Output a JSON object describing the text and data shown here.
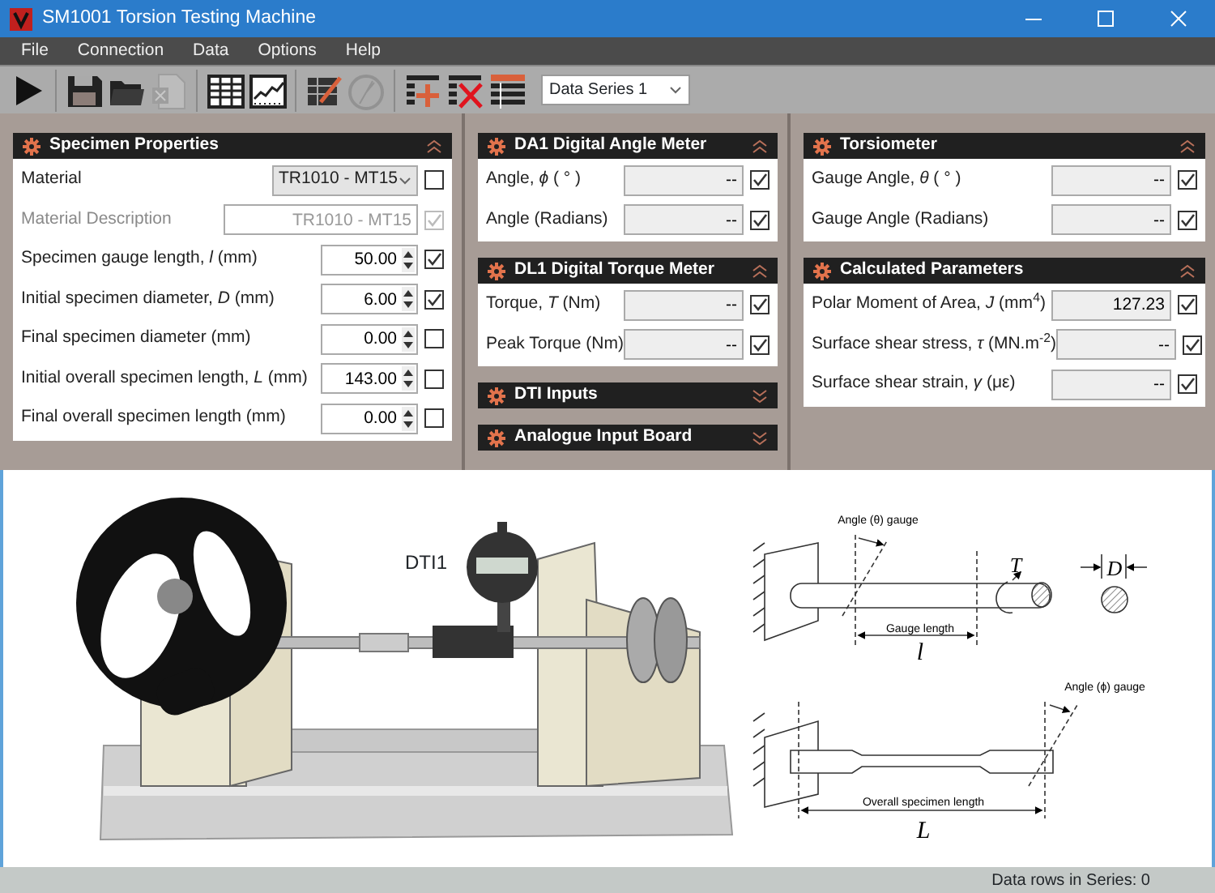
{
  "window": {
    "title": "SM1001 Torsion Testing Machine"
  },
  "menu": [
    "File",
    "Connection",
    "Data",
    "Options",
    "Help"
  ],
  "toolbar": {
    "groups": [
      [
        {
          "kind": "play",
          "disabled": false
        }
      ],
      [
        {
          "kind": "save",
          "disabled": false
        },
        {
          "kind": "open",
          "disabled": false
        },
        {
          "kind": "excel",
          "disabled": true
        }
      ],
      [
        {
          "kind": "table",
          "disabled": false
        },
        {
          "kind": "chart",
          "disabled": false
        }
      ],
      [
        {
          "kind": "edit",
          "disabled": false
        },
        {
          "kind": "clock",
          "disabled": true
        }
      ],
      [
        {
          "kind": "add-row",
          "disabled": false
        },
        {
          "kind": "delete-row",
          "disabled": false
        },
        {
          "kind": "header-row",
          "disabled": false
        }
      ]
    ],
    "series": {
      "value": "Data Series 1"
    }
  },
  "columns": [
    [
      {
        "title": "Specimen Properties",
        "expanded": true,
        "rows": [
          {
            "kind": "dropdown",
            "label": "Material",
            "value": "TR1010 - MT15",
            "checked": false,
            "disabled": false
          },
          {
            "kind": "text",
            "label": "Material Description",
            "value": "TR1010 - MT15",
            "checked": true,
            "disabled": true
          },
          {
            "kind": "spin",
            "label": "Specimen gauge length, *l*  (mm)",
            "value": "50.00",
            "checked": true,
            "disabled": false
          },
          {
            "kind": "spin",
            "label": "Initial specimen diameter, *D*  (mm)",
            "value": "6.00",
            "checked": true,
            "disabled": false
          },
          {
            "kind": "spin",
            "label": "Final specimen diameter  (mm)",
            "value": "0.00",
            "checked": false,
            "disabled": false
          },
          {
            "kind": "spin",
            "label": "Initial overall specimen length, *L*  (mm)",
            "value": "143.00",
            "checked": false,
            "disabled": false
          },
          {
            "kind": "spin",
            "label": "Final overall specimen length  (mm)",
            "value": "0.00",
            "checked": false,
            "disabled": false
          }
        ]
      }
    ],
    [
      {
        "title": "DA1 Digital Angle Meter",
        "expanded": true,
        "rows": [
          {
            "kind": "readout",
            "label": "Angle, *ϕ*  ( ° )",
            "value": "--",
            "checked": true,
            "disabled": false
          },
          {
            "kind": "readout",
            "label": "Angle  (Radians)",
            "value": "--",
            "checked": true,
            "disabled": false
          }
        ]
      },
      {
        "title": "DL1 Digital Torque Meter",
        "expanded": true,
        "rows": [
          {
            "kind": "readout",
            "label": "Torque, *T*  (Nm)",
            "value": "--",
            "checked": true,
            "disabled": false
          },
          {
            "kind": "readout",
            "label": "Peak Torque  (Nm)",
            "value": "--",
            "checked": true,
            "disabled": false
          }
        ]
      },
      {
        "title": "DTI Inputs",
        "expanded": false
      },
      {
        "title": "Analogue Input Board",
        "expanded": false
      }
    ],
    [
      {
        "title": "Torsiometer",
        "expanded": true,
        "rows": [
          {
            "kind": "readout",
            "label": "Gauge Angle, *θ*  ( ° )",
            "value": "--",
            "checked": true,
            "disabled": false
          },
          {
            "kind": "readout",
            "label": "Gauge Angle  (Radians)",
            "value": "--",
            "checked": true,
            "disabled": false
          }
        ]
      },
      {
        "title": "Calculated Parameters",
        "expanded": true,
        "rows": [
          {
            "kind": "readout",
            "label": "Polar Moment of Area, *J*  (mm$^{4}$)",
            "value": "127.23",
            "checked": true,
            "disabled": false
          },
          {
            "kind": "readout",
            "label": "Surface shear stress, *τ*  (MN.m$^{-2}$)",
            "value": "--",
            "checked": true,
            "disabled": false
          },
          {
            "kind": "readout",
            "label": "Surface shear strain, *γ*  (με)",
            "value": "--",
            "checked": true,
            "disabled": false
          }
        ]
      }
    ]
  ],
  "illustration": {
    "machine_label": "DTI1",
    "diagram_top": {
      "angle_gauge": "Angle (θ) gauge",
      "gauge_length": "Gauge length",
      "gauge_symbol": "l",
      "torque_symbol": "T",
      "diameter_symbol": "D"
    },
    "diagram_bottom": {
      "angle_gauge": "Angle (ϕ) gauge",
      "overall_length": "Overall specimen length",
      "length_symbol": "L"
    }
  },
  "status_bar": {
    "text": "Data rows in Series: 0"
  }
}
